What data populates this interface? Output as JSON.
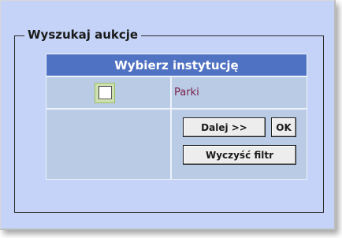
{
  "search_panel": {
    "legend": "Wyszukaj aukcje",
    "table": {
      "header": "Wybierz instytucję",
      "options": [
        {
          "label": "Parki",
          "checked": false
        }
      ]
    },
    "buttons": {
      "next_label": "Dalej >>",
      "ok_label": "OK",
      "clear_label": "Wyczyść filtr"
    }
  },
  "colors": {
    "panel_background": "#c4d3f7",
    "header_background": "#5072c2",
    "row_background": "#b9cbe5",
    "option_text": "#7a1f4a"
  }
}
